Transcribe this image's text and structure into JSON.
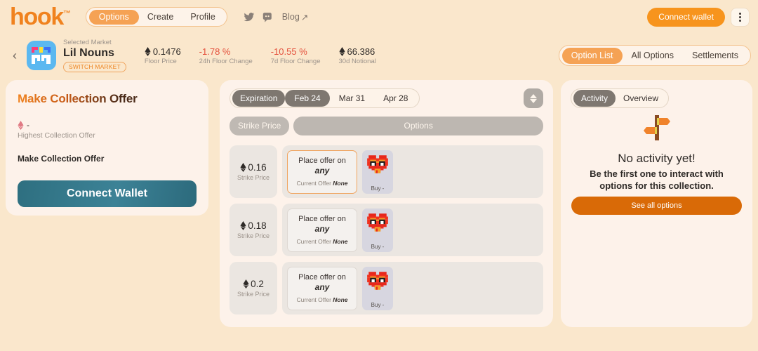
{
  "header": {
    "logo": "hook",
    "logo_tm": "™",
    "nav": [
      {
        "label": "Options",
        "active": true
      },
      {
        "label": "Create",
        "active": false
      },
      {
        "label": "Profile",
        "active": false
      }
    ],
    "social": [
      {
        "name": "twitter-icon"
      },
      {
        "name": "discord-icon"
      }
    ],
    "blog_label": "Blog",
    "blog_arrow": "↗",
    "connect_wallet": "Connect wallet",
    "kebab": "more-options"
  },
  "market_bar": {
    "back": "‹",
    "selected_market_label": "Selected Market",
    "market_name": "Lil Nouns",
    "switch_market": "SWITCH MARKET",
    "stats": [
      {
        "value": "0.1476",
        "label": "Floor Price",
        "eth": true,
        "negative": false
      },
      {
        "value": "-1.78 %",
        "label": "24h Floor Change",
        "eth": false,
        "negative": true
      },
      {
        "value": "-10.55 %",
        "label": "7d Floor Change",
        "eth": false,
        "negative": true
      },
      {
        "value": "66.386",
        "label": "30d Notional",
        "eth": true,
        "negative": false
      }
    ],
    "view_tabs": [
      {
        "label": "Option List",
        "active": true
      },
      {
        "label": "All Options",
        "active": false
      },
      {
        "label": "Settlements",
        "active": false
      }
    ]
  },
  "left_panel": {
    "title": "Make Collection Offer",
    "highest_value": "-",
    "highest_label": "Highest Collection Offer",
    "make_offer_label": "Make Collection Offer",
    "cta_label": "Connect Wallet"
  },
  "center_panel": {
    "expiration_label": "Expiration",
    "expirations": [
      {
        "label": "Feb 24",
        "active": true
      },
      {
        "label": "Mar 31",
        "active": false
      },
      {
        "label": "Apr 28",
        "active": false
      }
    ],
    "sort_button": "sort-toggle",
    "columns": {
      "strike": "Strike Price",
      "options": "Options"
    },
    "rows": [
      {
        "strike_value": "0.16",
        "strike_label": "Strike Price",
        "offer_line1": "Place offer on",
        "offer_line2": "any",
        "offer_current_label": "Current Offer",
        "offer_current_value": "None",
        "highlight": true,
        "buy_label": "Buy -",
        "nft_icon": "pixel-heart-sunglasses"
      },
      {
        "strike_value": "0.18",
        "strike_label": "Strike Price",
        "offer_line1": "Place offer on",
        "offer_line2": "any",
        "offer_current_label": "Current Offer",
        "offer_current_value": "None",
        "highlight": false,
        "buy_label": "Buy -",
        "nft_icon": "pixel-heart-sunglasses"
      },
      {
        "strike_value": "0.2",
        "strike_label": "Strike Price",
        "offer_line1": "Place offer on",
        "offer_line2": "any",
        "offer_current_label": "Current Offer",
        "offer_current_value": "None",
        "highlight": false,
        "buy_label": "Buy -",
        "nft_icon": "pixel-heart-sunglasses"
      }
    ]
  },
  "right_panel": {
    "tabs": [
      {
        "label": "Activity",
        "active": true
      },
      {
        "label": "Overview",
        "active": false
      }
    ],
    "empty_icon": "signpost-icon",
    "empty_title": "No activity yet!",
    "empty_subtitle": "Be the first one to interact with options for this collection.",
    "see_all_label": "See all options"
  },
  "colors": {
    "background": "#FAE7CC",
    "panel": "#FDF2EA",
    "accent_orange": "#F7941D",
    "accent_orange_light": "#F5A254",
    "negative_red": "#E4503C",
    "teal_cta": "#3C8296",
    "deep_orange": "#D96A07",
    "grey_pill": "#7E7770"
  }
}
